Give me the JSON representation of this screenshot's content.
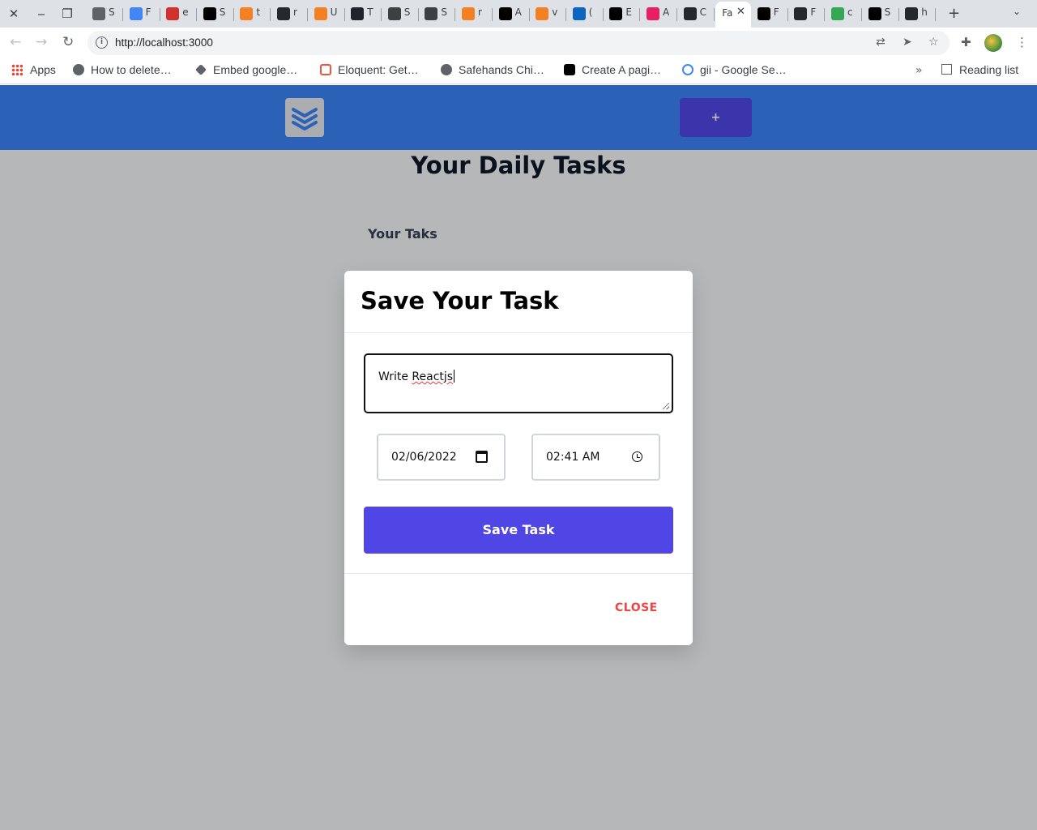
{
  "browser": {
    "tabs": [
      {
        "initial": "S",
        "icon": "globe-icon",
        "color": "#5f6368"
      },
      {
        "initial": "F",
        "icon": "google-icon",
        "color": "#4285f4"
      },
      {
        "initial": "e",
        "icon": "laravel-news-icon",
        "color": "#d32f2f"
      },
      {
        "initial": "S",
        "icon": "dev-icon",
        "color": "#000000"
      },
      {
        "initial": "t",
        "icon": "stackoverflow-icon",
        "color": "#f48024"
      },
      {
        "initial": "r",
        "icon": "github-icon",
        "color": "#24292e"
      },
      {
        "initial": "U",
        "icon": "stackoverflow-icon",
        "color": "#f48024"
      },
      {
        "initial": "T",
        "icon": "react-icon",
        "color": "#20232a"
      },
      {
        "initial": "S",
        "icon": "x-circle-icon",
        "color": "#3c4043"
      },
      {
        "initial": "S",
        "icon": "x-circle-icon",
        "color": "#3c4043"
      },
      {
        "initial": "r",
        "icon": "stackoverflow-icon",
        "color": "#f48024"
      },
      {
        "initial": "A",
        "icon": "medium-icon",
        "color": "#000000"
      },
      {
        "initial": "v",
        "icon": "stackoverflow-icon",
        "color": "#f48024"
      },
      {
        "initial": "(",
        "icon": "linkedin-icon",
        "color": "#0a66c2"
      },
      {
        "initial": "E",
        "icon": "medium-icon",
        "color": "#000000"
      },
      {
        "initial": "A",
        "icon": "pinkcircle-icon",
        "color": "#e91e63"
      },
      {
        "initial": "C",
        "icon": "github-icon",
        "color": "#24292e"
      },
      {
        "initial": "Fa",
        "icon": "page-icon",
        "color": "#ffffff"
      },
      {
        "initial": "F",
        "icon": "medium-icon",
        "color": "#000000"
      },
      {
        "initial": "F",
        "icon": "github-icon",
        "color": "#24292e"
      },
      {
        "initial": "c",
        "icon": "figma-icon",
        "color": "#34a853"
      },
      {
        "initial": "S",
        "icon": "dev-icon",
        "color": "#000000"
      },
      {
        "initial": "h",
        "icon": "github-icon",
        "color": "#24292e"
      }
    ],
    "url": "http://localhost:3000",
    "bookmarks": {
      "apps": "Apps",
      "b1": "How to delete…",
      "b2": "Embed google…",
      "b3": "Eloquent: Get…",
      "b4": "Safehands Chi…",
      "b5": "Create A pagi…",
      "b6": "gii - Google Se…"
    },
    "reading_list": "Reading list",
    "more": "»"
  },
  "app": {
    "add_label": "+",
    "title": "Your Daily Tasks",
    "section": "Your Taks"
  },
  "modal": {
    "title": "Save Your Task",
    "task_value_prefix": "Write ",
    "task_value_word": "Reactjs",
    "date_value": "02/06/2022",
    "time_value": "02:41 AM",
    "save_label": "Save Task",
    "close_label": "CLOSE"
  }
}
